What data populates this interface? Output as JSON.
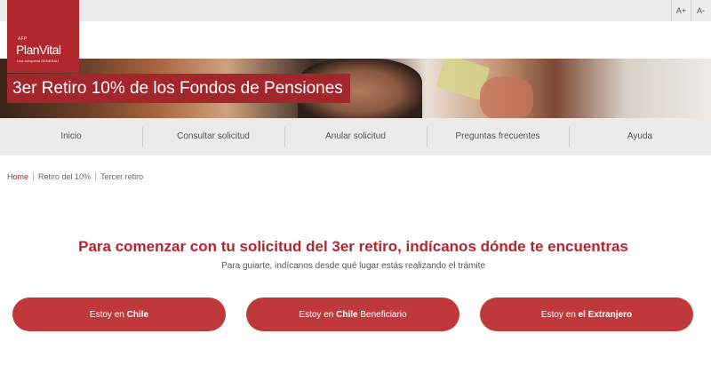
{
  "font_controls": {
    "increase_label": "A+",
    "decrease_label": "A-"
  },
  "logo": {
    "prefix": "AFP",
    "name": "PlanVital",
    "tagline": "Una compañía GENERALI",
    "brand_color": "#b0272d"
  },
  "hero": {
    "title": "3er Retiro 10% de los Fondos de Pensiones",
    "title_bg": "#a3262c"
  },
  "nav": {
    "items": [
      {
        "label": "Inicio"
      },
      {
        "label": "Consultar solicitud"
      },
      {
        "label": "Anular solicitud"
      },
      {
        "label": "Preguntas frecuentes"
      },
      {
        "label": "Ayuda"
      }
    ]
  },
  "breadcrumb": {
    "home": "Home",
    "level1": "Retiro del 10%",
    "current": "Tercer retiro"
  },
  "main": {
    "heading": "Para comenzar con tu solicitud del 3er retiro, indícanos dónde te encuentras",
    "subheading": "Para guiarte, indícanos desde qué lugar estás realizando el trámite",
    "buttons": [
      {
        "prefix": "Estoy en ",
        "bold": "Chile",
        "suffix": ""
      },
      {
        "prefix": "Estoy en ",
        "bold": "Chile",
        "suffix": " Beneficiario"
      },
      {
        "prefix": "Estoy en ",
        "bold": "el Extranjero",
        "suffix": ""
      }
    ],
    "button_color": "#c0393a"
  }
}
